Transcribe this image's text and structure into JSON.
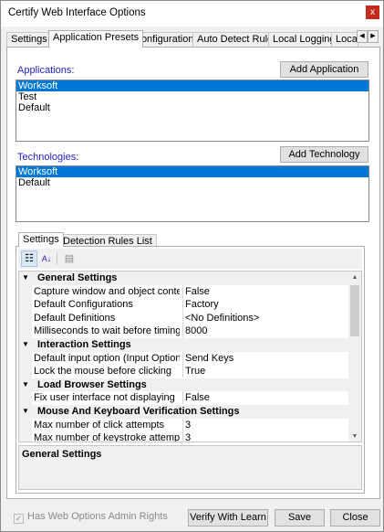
{
  "window": {
    "title": "Certify Web Interface Options",
    "close_glyph": "x"
  },
  "tabs": [
    {
      "label": "Settings"
    },
    {
      "label": "Application Presets"
    },
    {
      "label": "Configuration"
    },
    {
      "label": "Auto Detect Rules"
    },
    {
      "label": "Local Logging"
    },
    {
      "label": "Local"
    }
  ],
  "active_tab": "Application Presets",
  "tab_scroll": {
    "left": "◀",
    "right": "▶"
  },
  "applications": {
    "label": "Applications:",
    "add_button": "Add Application",
    "items": [
      {
        "label": "Worksoft",
        "selected": true
      },
      {
        "label": "Test",
        "selected": false
      },
      {
        "label": "Default",
        "selected": false
      }
    ]
  },
  "technologies": {
    "label": "Technologies:",
    "add_button": "Add Technology",
    "items": [
      {
        "label": "Worksoft",
        "selected": true
      },
      {
        "label": "Default",
        "selected": false
      }
    ]
  },
  "inner_tabs": [
    {
      "label": "Settings"
    },
    {
      "label": "Detection Rules List"
    }
  ],
  "toolbar": {
    "categorized_icon": "☷",
    "sort_icon": "A↓",
    "pages_icon": "▤"
  },
  "property_grid": {
    "rows": [
      {
        "type": "category",
        "name": "General Settings"
      },
      {
        "type": "property",
        "name": "Capture window and object contextual",
        "value": "False"
      },
      {
        "type": "property",
        "name": "Default Configurations",
        "value": "Factory"
      },
      {
        "type": "property",
        "name": "Default Definitions",
        "value": "<No Definitions>"
      },
      {
        "type": "property",
        "name": "Milliseconds to wait before timing out a",
        "value": "8000"
      },
      {
        "type": "category",
        "name": "Interaction Settings"
      },
      {
        "type": "property",
        "name": "Default input option (Input Options)",
        "value": "Send Keys"
      },
      {
        "type": "property",
        "name": "Lock the mouse before clicking",
        "value": "True"
      },
      {
        "type": "category",
        "name": "Load Browser Settings"
      },
      {
        "type": "property",
        "name": "Fix user interface not displaying",
        "value": "False"
      },
      {
        "type": "category",
        "name": "Mouse And Keyboard Verification Settings"
      },
      {
        "type": "property",
        "name": "Max number of click attempts",
        "value": "3"
      },
      {
        "type": "property",
        "name": "Max number of keystroke attempts",
        "value": "3"
      }
    ]
  },
  "description": {
    "title": "General Settings"
  },
  "footer": {
    "admin_rights_label": "Has Web Options Admin Rights",
    "admin_rights_checked": true,
    "verify_button": "Verify With Learn",
    "save_button": "Save",
    "close_button": "Close"
  },
  "colors": {
    "selection": "#0078d7",
    "label_blue": "#1e1ec8",
    "close_red": "#c42b1c"
  }
}
